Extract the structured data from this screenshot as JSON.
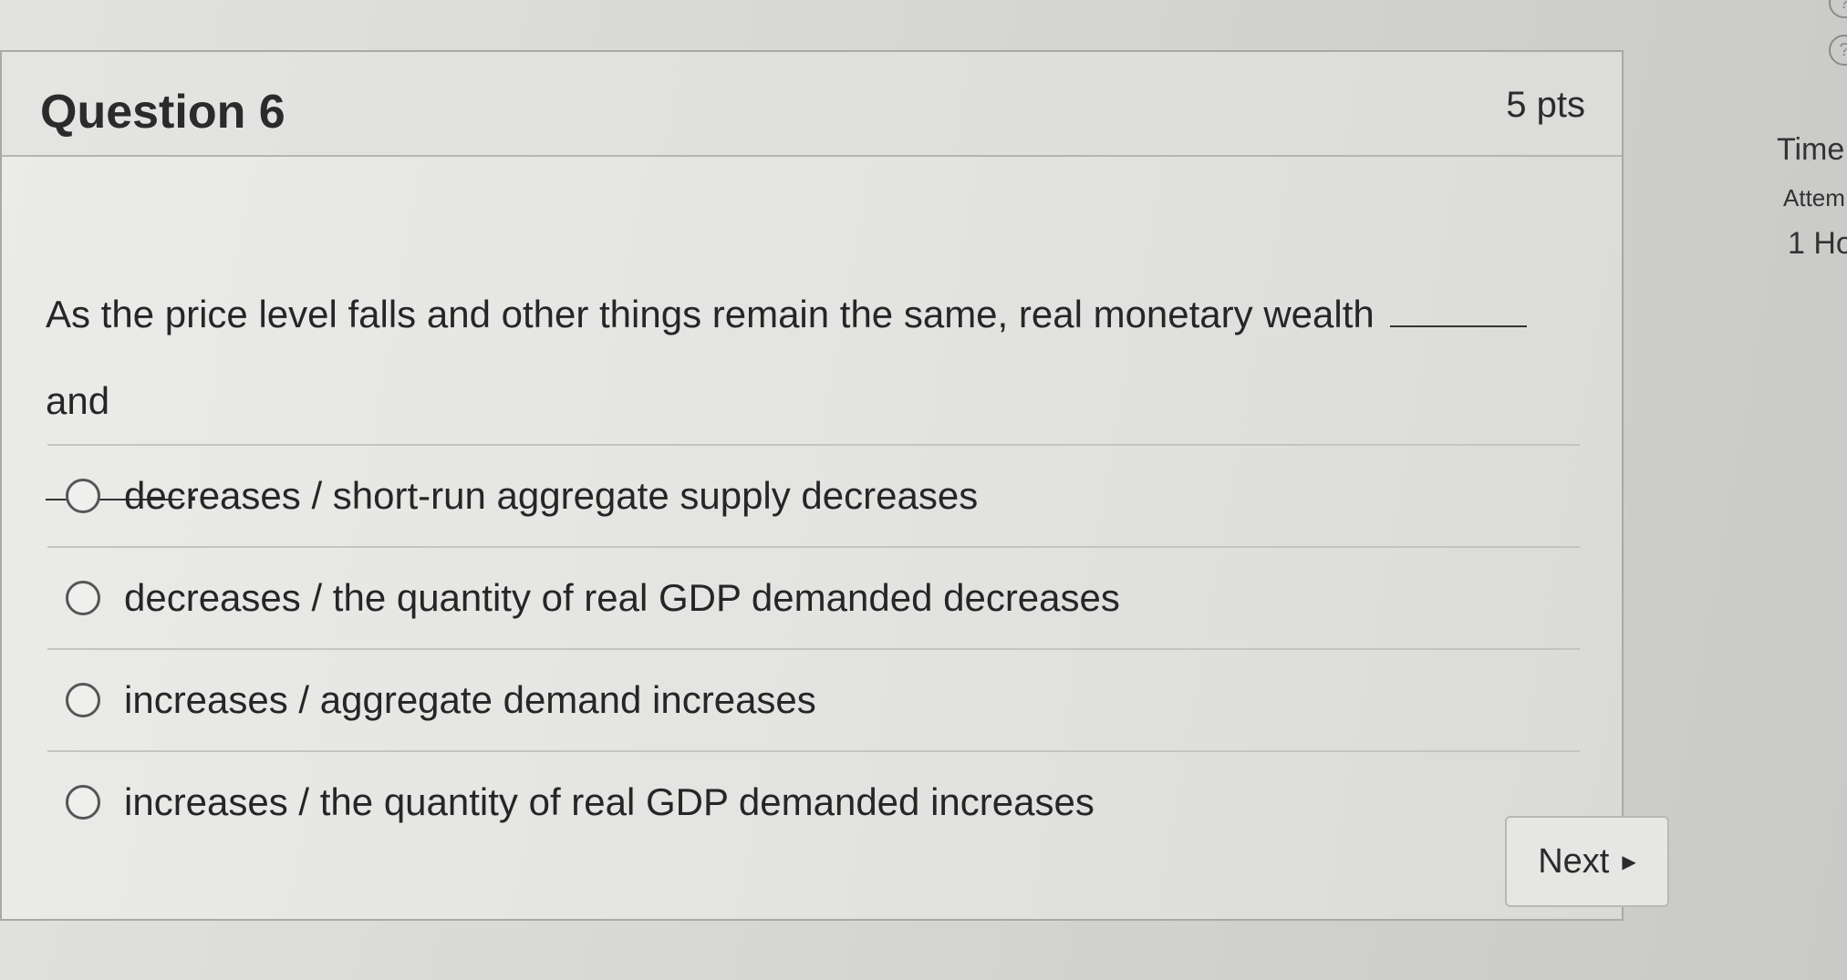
{
  "question": {
    "title": "Question 6",
    "points": "5 pts",
    "text_part1": "As the price level falls and other things remain the same, real monetary wealth",
    "text_connector": "and",
    "text_end": "."
  },
  "answers": [
    {
      "label": "decreases / short-run aggregate supply decreases"
    },
    {
      "label": "decreases / the quantity of real GDP demanded decreases"
    },
    {
      "label": "increases / aggregate demand increases"
    },
    {
      "label": "increases / the quantity of real GDP demanded increases"
    }
  ],
  "navigation": {
    "next_label": "Next",
    "next_icon": "caret-right-icon"
  },
  "sidebar": {
    "time_label": "Time",
    "attempt_label": "Attem",
    "attempt_value": "1 Ho"
  }
}
